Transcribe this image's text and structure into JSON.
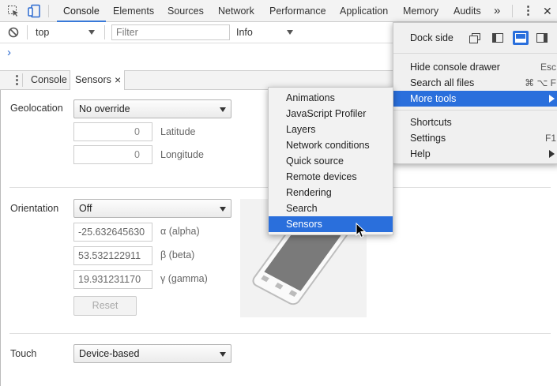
{
  "main_tabs": [
    "Console",
    "Elements",
    "Sources",
    "Network",
    "Performance",
    "Application",
    "Memory",
    "Audits"
  ],
  "main_toolbar": {
    "more_tabs": "»",
    "menu": "⋮",
    "close": "✕"
  },
  "console_toolbar": {
    "context_value": "top",
    "filter_placeholder": "Filter",
    "level_value": "Info"
  },
  "console": {
    "prompt": "›"
  },
  "drawer": {
    "tabs": [
      "Console",
      "Sensors"
    ],
    "close_tab": "×"
  },
  "sensors": {
    "geolocation": {
      "label": "Geolocation",
      "value": "No override",
      "latitude": "0",
      "latitude_label": "Latitude",
      "longitude": "0",
      "longitude_label": "Longitude"
    },
    "orientation": {
      "label": "Orientation",
      "value": "Off",
      "alpha": "-25.632645630",
      "alpha_label": "α (alpha)",
      "beta": "53.532122911",
      "beta_label": "β (beta)",
      "gamma": "19.931231170",
      "gamma_label": "γ (gamma)",
      "reset": "Reset"
    },
    "touch": {
      "label": "Touch",
      "value": "Device-based"
    }
  },
  "main_menu": {
    "dock_side_label": "Dock side",
    "items": [
      {
        "label": "Hide console drawer",
        "shortcut": "Esc"
      },
      {
        "label": "Search all files",
        "shortcut": "⌘ ⌥ F"
      },
      {
        "label": "More tools",
        "shortcut": ""
      },
      {
        "label": "Shortcuts",
        "shortcut": ""
      },
      {
        "label": "Settings",
        "shortcut": "F1"
      },
      {
        "label": "Help",
        "shortcut": ""
      }
    ]
  },
  "more_tools_menu": {
    "items": [
      "Animations",
      "JavaScript Profiler",
      "Layers",
      "Network conditions",
      "Quick source",
      "Remote devices",
      "Rendering",
      "Search",
      "Sensors"
    ],
    "highlighted": "Sensors"
  },
  "colors": {
    "accent": "#2a6fdc",
    "tab_underline": "#3879d9"
  }
}
